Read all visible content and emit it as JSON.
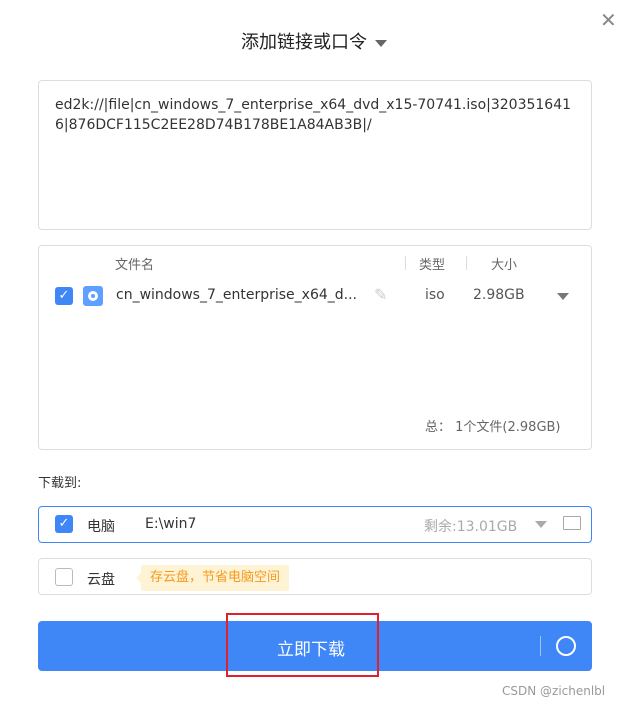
{
  "dialog": {
    "title": "添加链接或口令"
  },
  "link_input": {
    "value": "ed2k://|file|cn_windows_7_enterprise_x64_dvd_x15-70741.iso|3203516416|876DCF115C2EE28D74B178BE1A84AB3B|/"
  },
  "file_table": {
    "columns": [
      "文件名",
      "类型",
      "大小"
    ],
    "rows": [
      {
        "checked": true,
        "name": "cn_windows_7_enterprise_x64_d...",
        "type": "iso",
        "size": "2.98GB"
      }
    ],
    "summary_label": "总：",
    "summary_value": "1个文件(2.98GB)"
  },
  "download_to": {
    "label": "下载到:",
    "pc": {
      "checked": true,
      "label": "电脑",
      "path": "E:\\win7",
      "free": "剩余:13.01GB"
    },
    "cloud": {
      "checked": false,
      "label": "云盘",
      "tip": "存云盘，节省电脑空间"
    }
  },
  "download_button": {
    "label": "立即下载"
  },
  "watermark": "CSDN @zichenlbl",
  "colors": {
    "accent": "#3f86f7",
    "highlight_box": "#e0202a"
  }
}
